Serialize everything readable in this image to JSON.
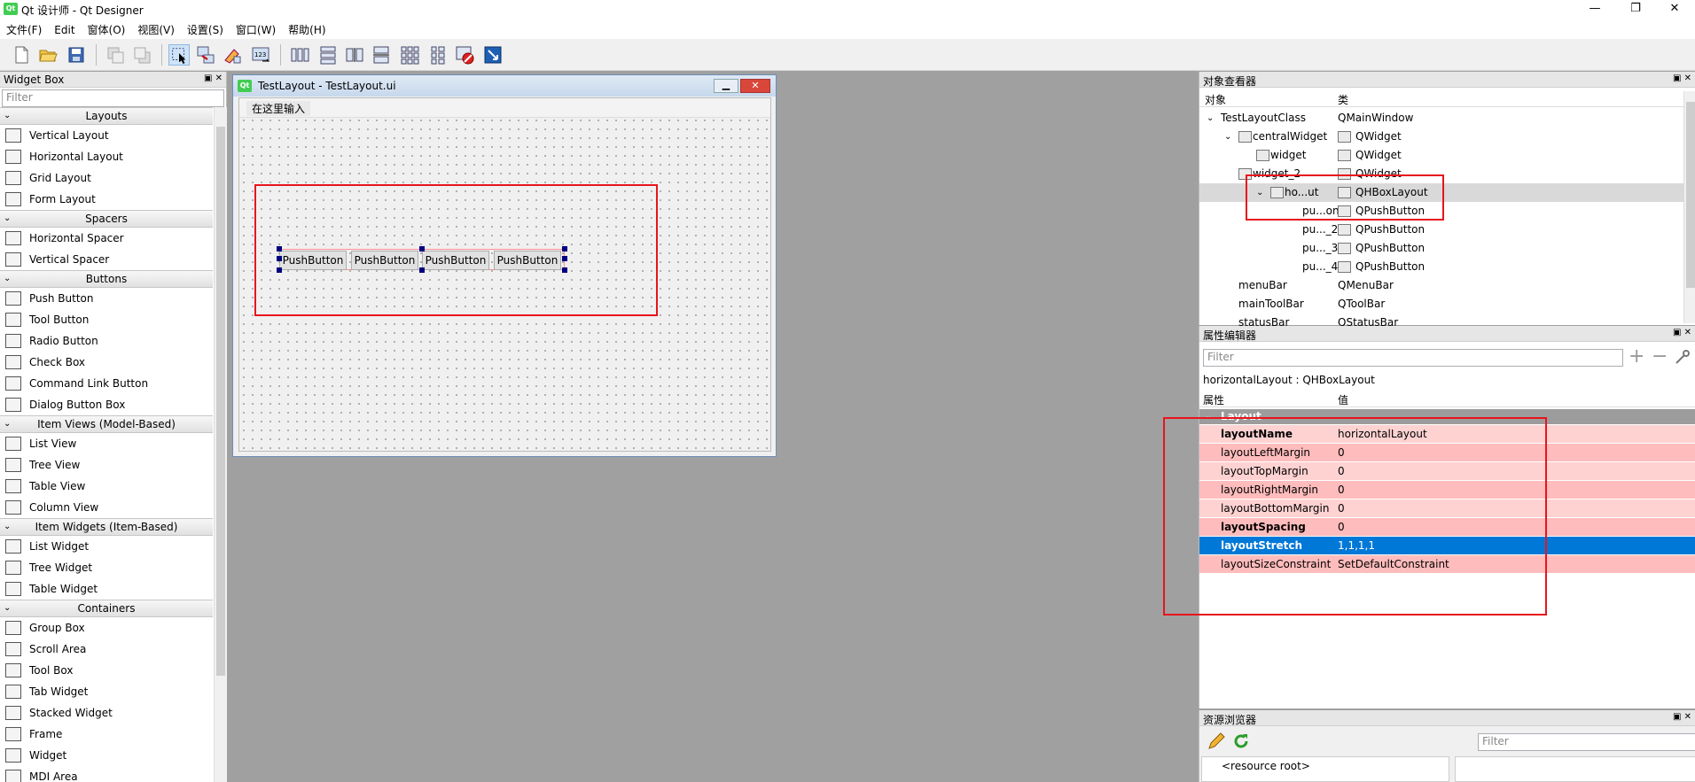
{
  "app": {
    "title": "Qt 设计师 - Qt Designer",
    "qt_logo": "Qt",
    "win_min": "—",
    "win_max": "❐",
    "win_close": "✕"
  },
  "menu": [
    "文件(F)",
    "Edit",
    "窗体(O)",
    "视图(V)",
    "设置(S)",
    "窗口(W)",
    "帮助(H)"
  ],
  "widget_box": {
    "title": "Widget Box",
    "filter_placeholder": "Filter",
    "categories": [
      {
        "label": "Layouts",
        "items": [
          "Vertical Layout",
          "Horizontal Layout",
          "Grid Layout",
          "Form Layout"
        ]
      },
      {
        "label": "Spacers",
        "items": [
          "Horizontal Spacer",
          "Vertical Spacer"
        ]
      },
      {
        "label": "Buttons",
        "items": [
          "Push Button",
          "Tool Button",
          "Radio Button",
          "Check Box",
          "Command Link Button",
          "Dialog Button Box"
        ]
      },
      {
        "label": "Item Views (Model-Based)",
        "items": [
          "List View",
          "Tree View",
          "Table View",
          "Column View"
        ]
      },
      {
        "label": "Item Widgets (Item-Based)",
        "items": [
          "List Widget",
          "Tree Widget",
          "Table Widget"
        ]
      },
      {
        "label": "Containers",
        "items": [
          "Group Box",
          "Scroll Area",
          "Tool Box",
          "Tab Widget",
          "Stacked Widget",
          "Frame",
          "Widget",
          "MDI Area"
        ]
      }
    ]
  },
  "form": {
    "title": "TestLayout - TestLayout.ui",
    "menu_placeholder": "在这里输入",
    "buttons": [
      "PushButton",
      "PushButton",
      "PushButton",
      "PushButton"
    ]
  },
  "object_inspector": {
    "title": "对象查看器",
    "col_object": "对象",
    "col_class": "类",
    "rows": [
      {
        "name": "TestLayoutClass",
        "cls": "QMainWindow"
      },
      {
        "name": "centralWidget",
        "cls": "QWidget"
      },
      {
        "name": "widget",
        "cls": "QWidget"
      },
      {
        "name": "widget_2",
        "cls": "QWidget"
      },
      {
        "name": "ho...ut",
        "cls": "QHBoxLayout"
      },
      {
        "name": "pu...on",
        "cls": "QPushButton"
      },
      {
        "name": "pu..._2",
        "cls": "QPushButton"
      },
      {
        "name": "pu..._3",
        "cls": "QPushButton"
      },
      {
        "name": "pu..._4",
        "cls": "QPushButton"
      },
      {
        "name": "menuBar",
        "cls": "QMenuBar"
      },
      {
        "name": "mainToolBar",
        "cls": "QToolBar"
      },
      {
        "name": "statusBar",
        "cls": "QStatusBar"
      }
    ]
  },
  "property_editor": {
    "title": "属性编辑器",
    "filter_placeholder": "Filter",
    "plus": "+",
    "minus": "−",
    "context": "horizontalLayout : QHBoxLayout",
    "col_property": "属性",
    "col_value": "值",
    "group": "Layout",
    "props": [
      {
        "key": "layoutName",
        "value": "horizontalLayout"
      },
      {
        "key": "layoutLeftMargin",
        "value": "0"
      },
      {
        "key": "layoutTopMargin",
        "value": "0"
      },
      {
        "key": "layoutRightMargin",
        "value": "0"
      },
      {
        "key": "layoutBottomMargin",
        "value": "0"
      },
      {
        "key": "layoutSpacing",
        "value": "0"
      },
      {
        "key": "layoutStretch",
        "value": "1,1,1,1"
      },
      {
        "key": "layoutSizeConstraint",
        "value": "SetDefaultConstraint"
      }
    ]
  },
  "resource_browser": {
    "title": "资源浏览器",
    "filter_placeholder": "Filter",
    "root": "<resource root>"
  },
  "colors": {
    "highlight": "#0078d7",
    "annotation_red": "#e8141c",
    "prop_pink": "#ffd2d2",
    "prop_pink_alt": "#ffbcbc",
    "group_gray": "#9c9c9c"
  }
}
